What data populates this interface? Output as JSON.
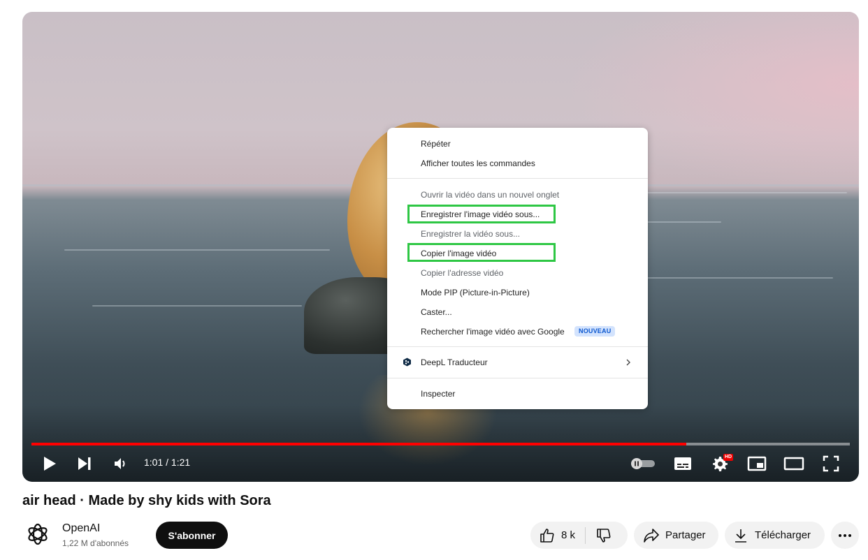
{
  "player": {
    "time_display": "1:01 / 1:21",
    "progress": 0.8,
    "hd_badge": "HD"
  },
  "context_menu": {
    "items": [
      {
        "label": "Répéter",
        "enabled": true
      },
      {
        "label": "Afficher toutes les commandes",
        "enabled": true
      },
      {
        "label": "Ouvrir la vidéo dans un nouvel onglet",
        "enabled": false
      },
      {
        "label": "Enregistrer l'image vidéo sous...",
        "enabled": true,
        "highlighted": true
      },
      {
        "label": "Enregistrer la vidéo sous...",
        "enabled": false
      },
      {
        "label": "Copier l'image vidéo",
        "enabled": true,
        "highlighted": true
      },
      {
        "label": "Copier l'adresse vidéo",
        "enabled": false
      },
      {
        "label": "Mode PIP (Picture-in-Picture)",
        "enabled": true
      },
      {
        "label": "Caster...",
        "enabled": true
      },
      {
        "label": "Rechercher l'image vidéo avec Google",
        "enabled": true,
        "badge": "NOUVEAU"
      },
      {
        "label": "DeepL Traducteur",
        "enabled": true,
        "submenu": true,
        "icon": "deepl-icon"
      },
      {
        "label": "Inspecter",
        "enabled": true
      }
    ]
  },
  "video": {
    "title": "air head · Made by shy kids with Sora"
  },
  "channel": {
    "name": "OpenAI",
    "subscribers": "1,22 M d'abonnés",
    "subscribe_label": "S'abonner"
  },
  "actions": {
    "like_count": "8 k",
    "share_label": "Partager",
    "download_label": "Télécharger"
  },
  "colors": {
    "progress": "#ff0000",
    "highlight_box": "#2ec744",
    "badge_bg": "#d3e3fd",
    "badge_text": "#0b57d0"
  }
}
